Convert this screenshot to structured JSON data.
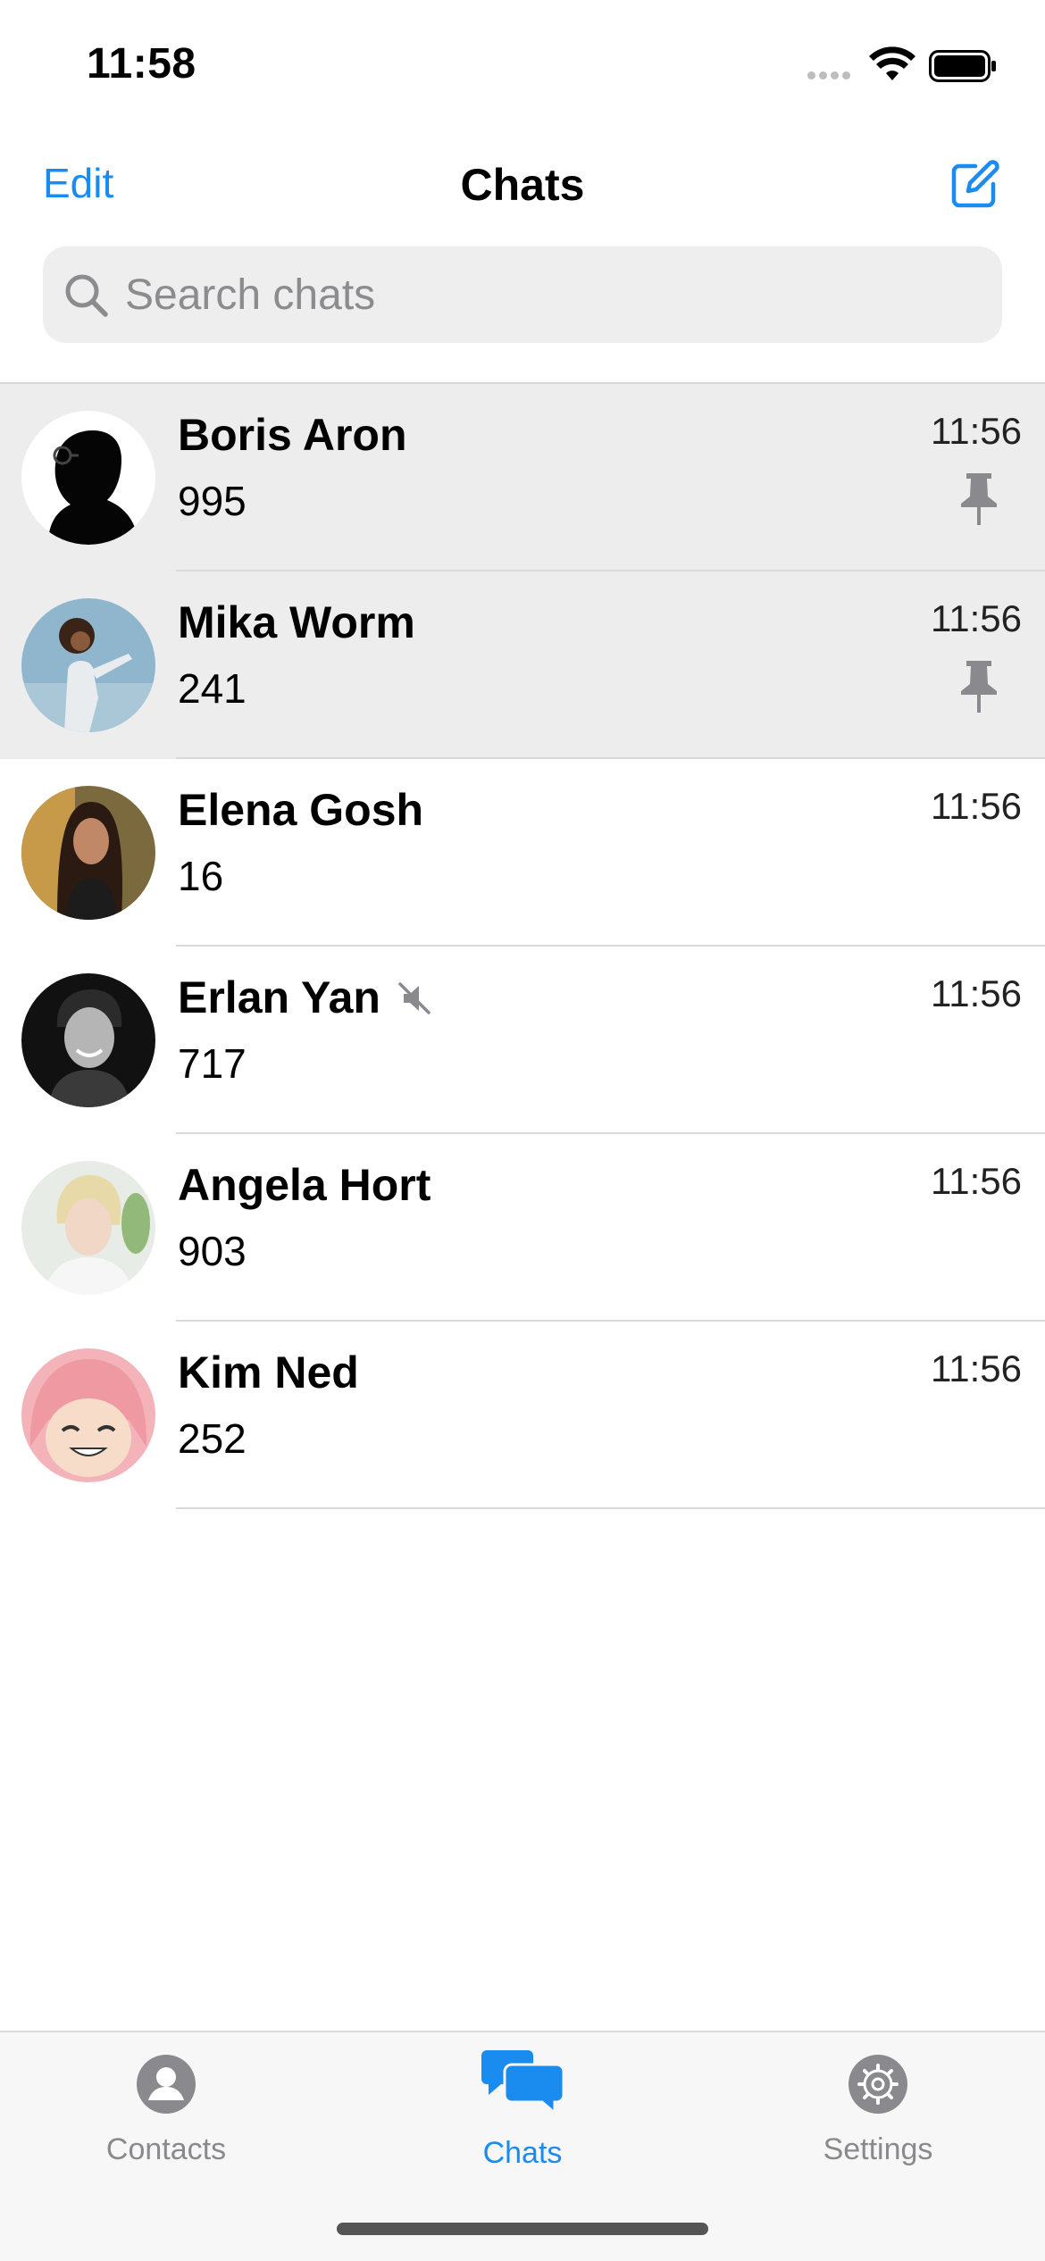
{
  "status_bar": {
    "time": "11:58"
  },
  "nav": {
    "edit_label": "Edit",
    "title": "Chats"
  },
  "search": {
    "placeholder": "Search chats",
    "value": ""
  },
  "chats": [
    {
      "name": "Boris Aron",
      "preview": "995",
      "time": "11:56",
      "pinned": true,
      "muted": false
    },
    {
      "name": "Mika Worm",
      "preview": "241",
      "time": "11:56",
      "pinned": true,
      "muted": false
    },
    {
      "name": "Elena Gosh",
      "preview": "16",
      "time": "11:56",
      "pinned": false,
      "muted": false
    },
    {
      "name": "Erlan Yan",
      "preview": "717",
      "time": "11:56",
      "pinned": false,
      "muted": true
    },
    {
      "name": "Angela Hort",
      "preview": "903",
      "time": "11:56",
      "pinned": false,
      "muted": false
    },
    {
      "name": "Kim Ned",
      "preview": "252",
      "time": "11:56",
      "pinned": false,
      "muted": false
    }
  ],
  "tabs": [
    {
      "label": "Contacts",
      "icon": "person-circle-icon",
      "active": false
    },
    {
      "label": "Chats",
      "icon": "chat-bubbles-icon",
      "active": true
    },
    {
      "label": "Settings",
      "icon": "gear-icon",
      "active": false
    }
  ],
  "colors": {
    "accent": "#1a8cf0",
    "pinned_row_bg": "#ededed",
    "tab_inactive": "#8a8a8e"
  }
}
